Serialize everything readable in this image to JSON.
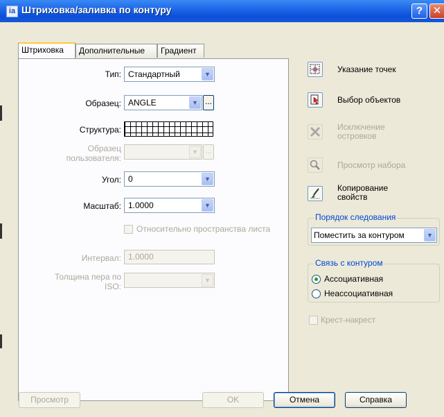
{
  "window": {
    "title": "Штриховка/заливка по контуру",
    "app_icon": "hatch-app-icon",
    "help_glyph": "?",
    "close_glyph": "✕"
  },
  "tabs": [
    {
      "label": "Штриховка",
      "active": true
    },
    {
      "label": "Дополнительные",
      "active": false
    },
    {
      "label": "Градиент",
      "active": false
    }
  ],
  "hatch": {
    "type_label": "Тип:",
    "type_value": "Стандартный",
    "pattern_label": "Образец:",
    "pattern_value": "ANGLE",
    "pattern_browse": "...",
    "swatch_label": "Структура:",
    "custom_label_1": "Образец",
    "custom_label_2": "пользователя:",
    "custom_browse": "...",
    "angle_label": "Угол:",
    "angle_value": "0",
    "scale_label": "Масштаб:",
    "scale_value": "1.0000",
    "relative_label": "Относительно пространства листа",
    "spacing_label": "Интервал:",
    "spacing_value": "1.0000",
    "iso_label_1": "Толщина пера по",
    "iso_label_2": "ISO:"
  },
  "actions": {
    "pick_points": "Указание точек",
    "select_objects": "Выбор объектов",
    "remove_islands_1": "Исключение",
    "remove_islands_2": "островков",
    "view_selections": "Просмотр набора",
    "inherit_1": "Копирование",
    "inherit_2": "свойств"
  },
  "draw_order": {
    "title": "Порядок следования",
    "value": "Поместить за контуром"
  },
  "composition": {
    "title": "Связь с контуром",
    "associative": "Ассоциативная",
    "nonassociative": "Неассоциативная",
    "selected": "associative"
  },
  "double_label": "Крест-накрест",
  "buttons": {
    "preview": "Просмотр",
    "ok": "OK",
    "cancel": "Отмена",
    "help": "Справка"
  },
  "colors": {
    "title_bar": "#0a4fd8",
    "dialog_bg": "#ece9d8",
    "group_title": "#0046d5",
    "radio_dot": "#21a121",
    "disabled_text": "#aca899"
  }
}
